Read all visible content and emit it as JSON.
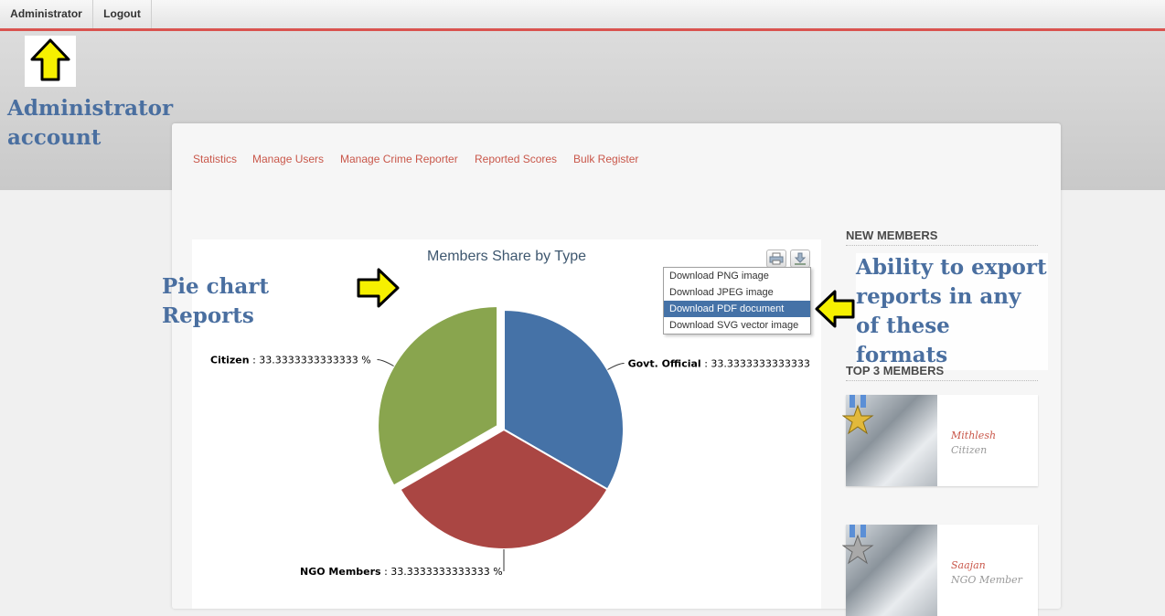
{
  "topbar": {
    "user_label": "Administrator",
    "logout_label": "Logout"
  },
  "annotations": {
    "admin": "Administrator account",
    "pie": "Pie chart Reports",
    "export": "Ability to export reports in any of these formats"
  },
  "nav": [
    "Statistics",
    "Manage Users",
    "Manage Crime Reporter",
    "Reported Scores",
    "Bulk Register"
  ],
  "chart_data": {
    "type": "pie",
    "title": "Members Share by Type",
    "slices": [
      {
        "name": "Govt. Official",
        "value": 33.3333333333333,
        "color": "#4572a7",
        "label": "Govt. Official",
        "value_text": ": 33.3333333333333"
      },
      {
        "name": "NGO Members",
        "value": 33.3333333333333,
        "color": "#aa4643",
        "label": "NGO Members",
        "value_text": ": 33.3333333333333 %"
      },
      {
        "name": "Citizen",
        "value": 33.3333333333333,
        "color": "#89a54e",
        "label": "Citizen",
        "value_text": ": 33.3333333333333 %"
      }
    ]
  },
  "export_menu": [
    "Download PNG image",
    "Download JPEG image",
    "Download PDF document",
    "Download SVG vector image"
  ],
  "sidebar": {
    "new_members_title": "NEW MEMBERS",
    "top_members_title": "TOP 3 MEMBERS",
    "members": [
      {
        "name": "Mithlesh",
        "role": "Citizen",
        "medal_color": "#e2b93b"
      },
      {
        "name": "Saajan",
        "role": "NGO Member",
        "medal_color": "#a9a9a9"
      }
    ]
  }
}
